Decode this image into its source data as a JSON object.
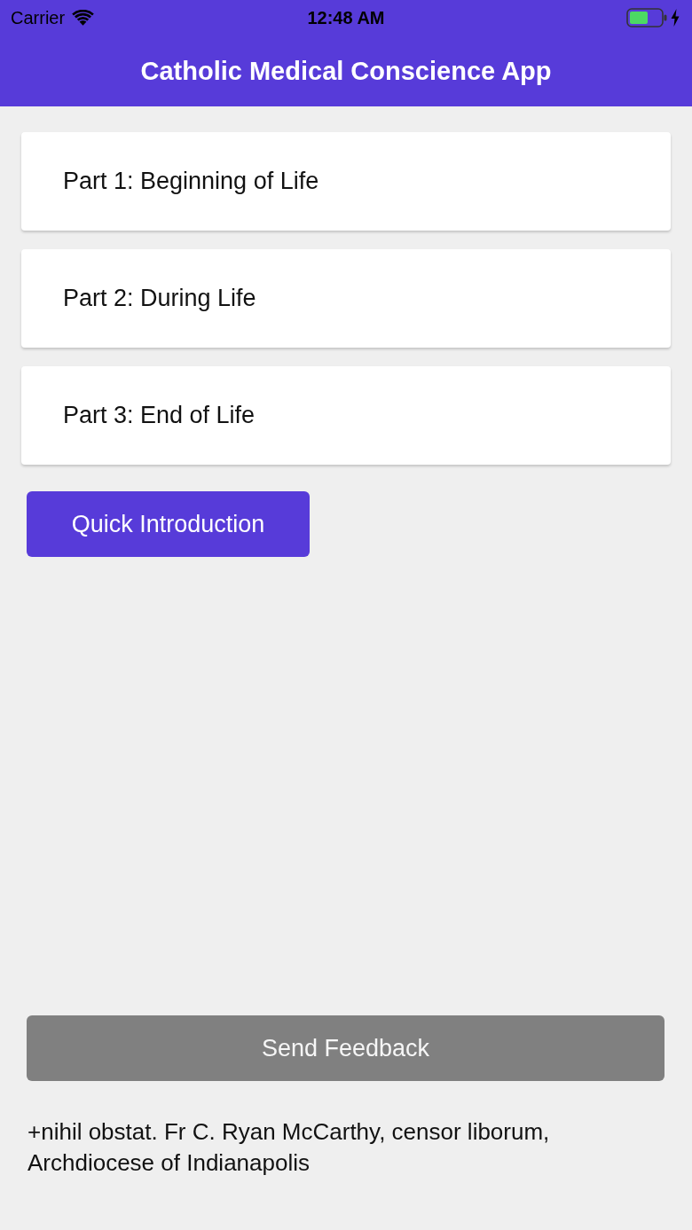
{
  "status_bar": {
    "carrier": "Carrier",
    "time": "12:48 AM"
  },
  "header": {
    "title": "Catholic Medical Conscience App"
  },
  "sections": [
    {
      "label": "Part 1: Beginning of Life"
    },
    {
      "label": "Part 2: During Life"
    },
    {
      "label": "Part 3: End of Life"
    }
  ],
  "intro_button": {
    "label": "Quick Introduction"
  },
  "feedback_button": {
    "label": "Send Feedback"
  },
  "footer": {
    "text": "+nihil obstat. Fr C. Ryan McCarthy, censor liborum, Archdiocese of Indianapolis"
  }
}
